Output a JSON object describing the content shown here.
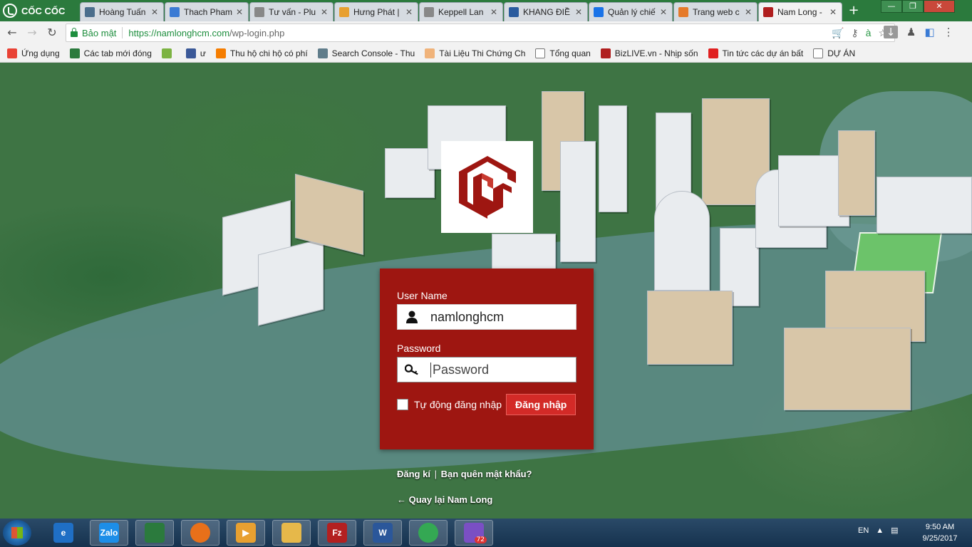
{
  "browser": {
    "brand": "CỐC CỐC",
    "tabs": [
      {
        "title": "Hoàng Tuấn",
        "color": "#4b6e8c"
      },
      {
        "title": "Thach Pham",
        "color": "#3b7bd4"
      },
      {
        "title": "Tư vấn - Plu",
        "color": "#888888"
      },
      {
        "title": "Hưng Phát |",
        "color": "#e8a030"
      },
      {
        "title": "Keppell Lan",
        "color": "#888888"
      },
      {
        "title": "KHANG ĐIỀ",
        "color": "#2a5b9e"
      },
      {
        "title": "Quản lý chiế",
        "color": "#1a73e8"
      },
      {
        "title": "Trang web c",
        "color": "#e57a2a"
      },
      {
        "title": "Nam Long -",
        "color": "#b01e1e",
        "active": true
      }
    ],
    "new_tab": "+",
    "secure_label": "Bảo mật",
    "url_host": "https://namlonghcm.com",
    "url_path": "/wp-login.php",
    "bookmarks": [
      {
        "label": "Ứng dụng",
        "icon": "apps-grid-icon",
        "color": "#e94235"
      },
      {
        "label": "Các tab mới đóng",
        "icon": "history-icon",
        "color": "#2b7a3d"
      },
      {
        "label": "",
        "icon": "check-icon",
        "color": "#7cb342"
      },
      {
        "label": "ư",
        "icon": "facebook-icon",
        "color": "#3b5998"
      },
      {
        "label": "Thu hộ chi hộ có phí",
        "icon": "blogger-icon",
        "color": "#f57d00"
      },
      {
        "label": "Search Console - Thu",
        "icon": "search-console-icon",
        "color": "#607d8b"
      },
      {
        "label": "Tài Liệu Thi Chứng Ch",
        "icon": "avatar-icon",
        "color": "#f0b37a"
      },
      {
        "label": "Tổng quan",
        "icon": "page-icon",
        "color": "#ffffff"
      },
      {
        "label": "BizLIVE.vn - Nhịp sốn",
        "icon": "bizlive-icon",
        "color": "#b01e1e"
      },
      {
        "label": "Tin tức các dự án bất",
        "icon": "f-icon",
        "color": "#e02020"
      },
      {
        "label": "DỰ ÁN",
        "icon": "page-icon",
        "color": "#ffffff"
      }
    ]
  },
  "login": {
    "username_label": "User Name",
    "username_value": "namlonghcm",
    "password_label": "Password",
    "password_placeholder": "Password",
    "remember_label": "Tự động đăng nhập",
    "submit_label": "Đăng nhập",
    "brand_color": "#9e1611"
  },
  "footer": {
    "register": "Đăng kí",
    "separator": "|",
    "lost_password": "Bạn quên mật khẩu?",
    "back": "← Quay lại Nam Long"
  },
  "taskbar": {
    "apps": [
      {
        "name": "internet-explorer",
        "label": "e"
      },
      {
        "name": "zalo",
        "label": "Zalo"
      },
      {
        "name": "coc-coc",
        "label": ""
      },
      {
        "name": "firefox",
        "label": ""
      },
      {
        "name": "media-player",
        "label": "▶"
      },
      {
        "name": "file-explorer",
        "label": ""
      },
      {
        "name": "filezilla",
        "label": "Fz"
      },
      {
        "name": "word",
        "label": "W"
      },
      {
        "name": "chrome",
        "label": ""
      },
      {
        "name": "viber",
        "label": "",
        "badge": "72"
      }
    ],
    "language": "EN",
    "time": "9:50 AM",
    "date": "9/25/2017"
  }
}
